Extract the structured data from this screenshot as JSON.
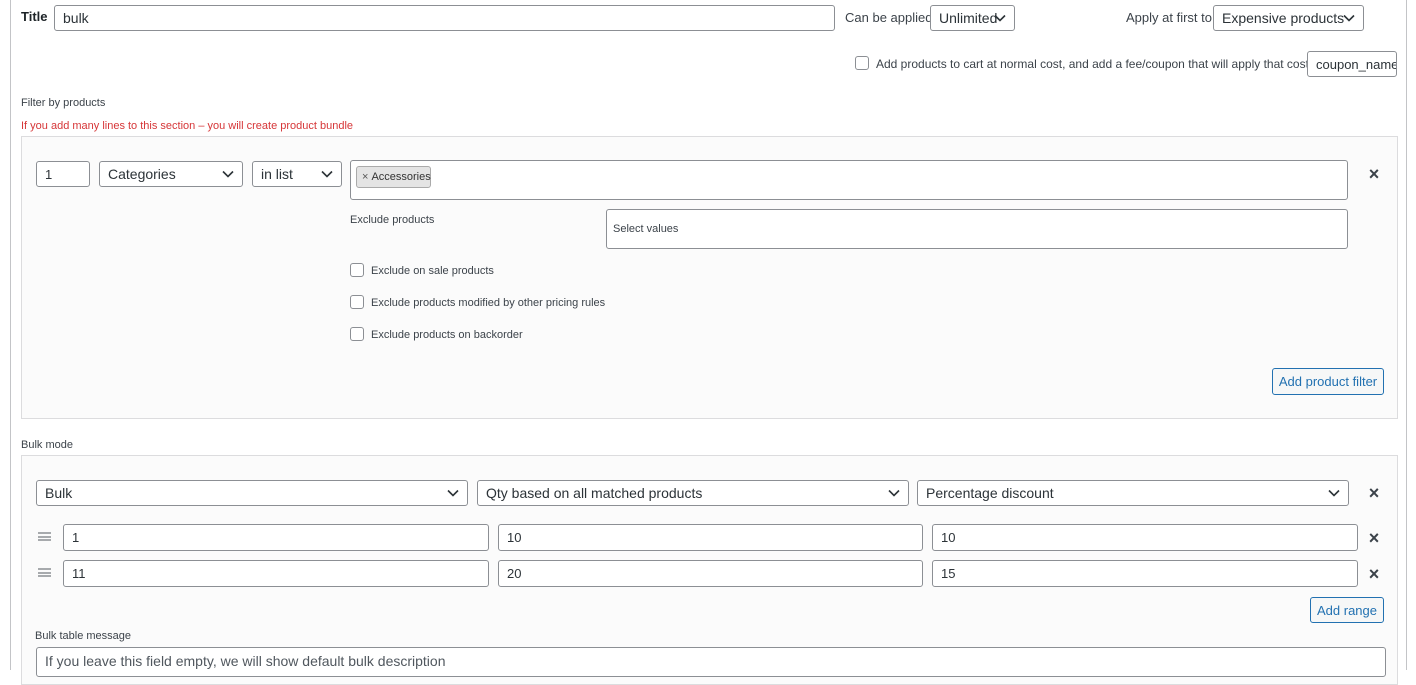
{
  "rule": {
    "title_label": "Title",
    "title_value": "bulk",
    "can_be_applied_label": "Can be applied:",
    "can_be_applied_value": "Unlimited",
    "apply_first_label": "Apply at first to:",
    "apply_first_value": "Expensive products",
    "add_fee_label": "Add products to cart at normal cost, and add a fee/coupon that will apply that cost",
    "coupon_value": "coupon_name"
  },
  "filter": {
    "section_label": "Filter by products",
    "warning": "If you add many lines to this section – you will create product bundle",
    "qty": "1",
    "type": "Categories",
    "method": "in list",
    "tag_remove": "×",
    "tag": "Accessories",
    "exclude_label": "Exclude products",
    "exclude_placeholder": "Select values",
    "checks": [
      "Exclude on sale products",
      "Exclude products modified by other pricing rules",
      "Exclude products on backorder"
    ],
    "remove": "×",
    "add_button": "Add product filter"
  },
  "bulk": {
    "section_label": "Bulk mode",
    "mode": "Bulk",
    "qty_based": "Qty based on all matched products",
    "discount_type": "Percentage discount",
    "remove": "×",
    "ranges": [
      {
        "from": "1",
        "to": "10",
        "value": "10",
        "remove": "×"
      },
      {
        "from": "11",
        "to": "20",
        "value": "15",
        "remove": "×"
      }
    ],
    "add_range": "Add range",
    "message_label": "Bulk table message",
    "message_placeholder": "If you leave this field empty, we will show default bulk description"
  },
  "colors": {
    "warning": "#d63638",
    "accent": "#2271b1",
    "border": "#8c8f94"
  }
}
